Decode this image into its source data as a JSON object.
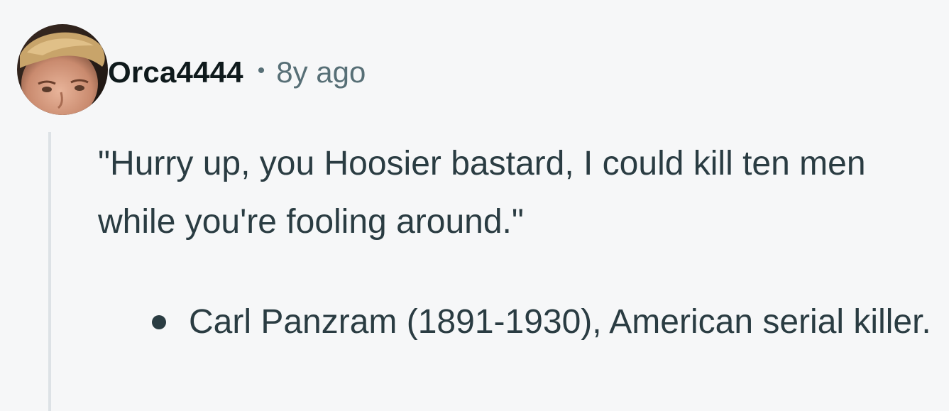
{
  "comment": {
    "author": "Orca4444",
    "separator": "•",
    "timestamp": "8y ago",
    "avatar_icon": "user-avatar-icon",
    "quote": "\"Hurry up, you Hoosier bastard, I could kill ten men while you're fooling around.\"",
    "list_items": [
      "Carl Panzram (1891-1930), American serial killer."
    ]
  },
  "colors": {
    "background": "#f6f7f8",
    "username": "#0f1a1c",
    "meta": "#576f76",
    "body_text": "#2a3c42",
    "thread_line": "#dde2e6"
  }
}
